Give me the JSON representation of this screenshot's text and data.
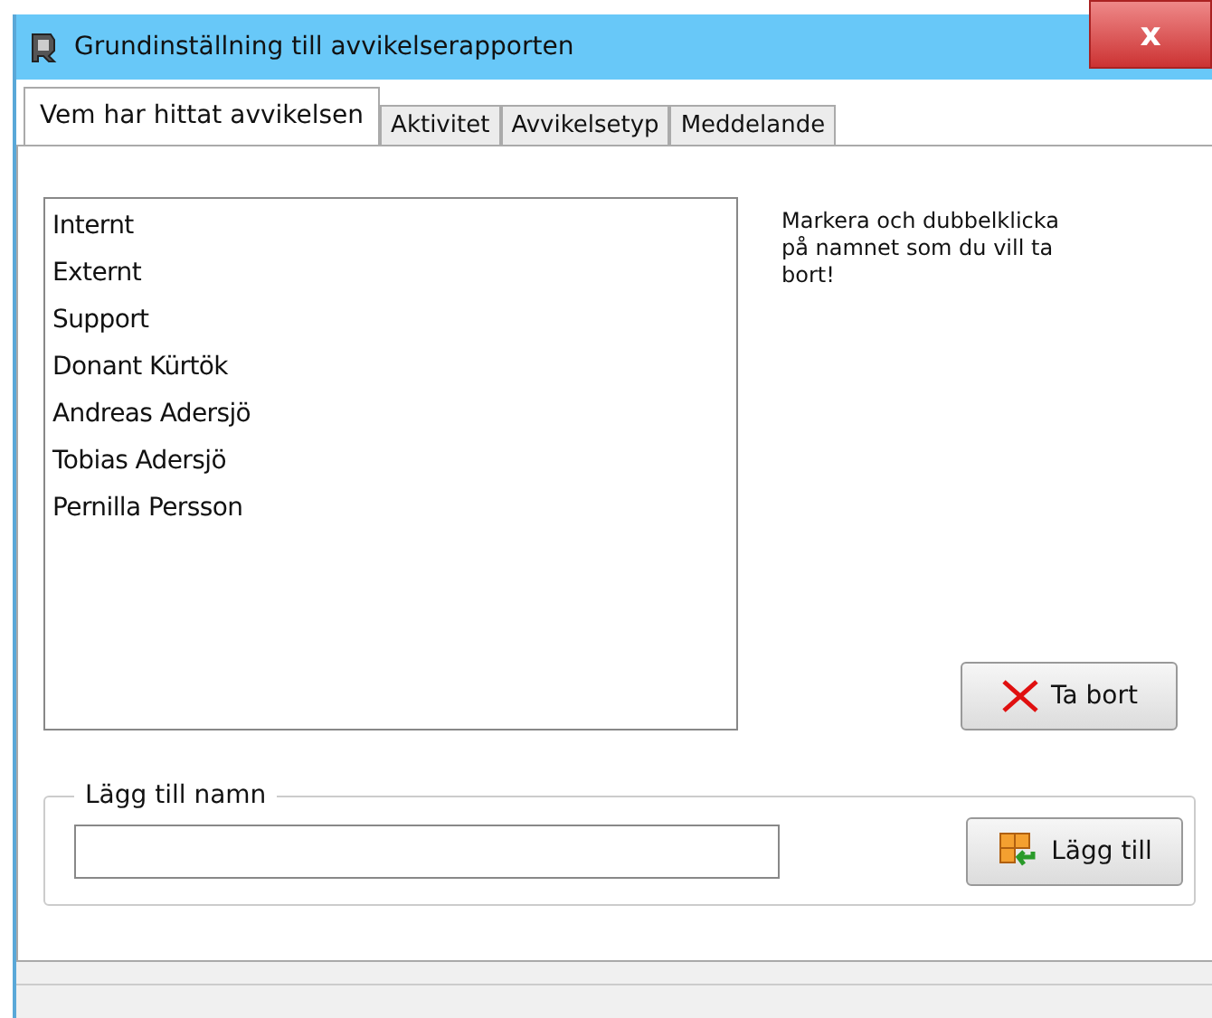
{
  "window": {
    "title": "Grundinställning till avvikelserapporten",
    "close": "x"
  },
  "tabs": [
    {
      "label": "Vem har hittat avvikelsen",
      "selected": true
    },
    {
      "label": "Aktivitet",
      "selected": false
    },
    {
      "label": "Avvikelsetyp",
      "selected": false
    },
    {
      "label": "Meddelande",
      "selected": false
    }
  ],
  "names_list": {
    "items": [
      "Internt",
      "Externt",
      "Support",
      "Donant Kürtök",
      "Andreas Adersjö",
      "Tobias Adersjö",
      "Pernilla Persson"
    ]
  },
  "help_text": "Markera och dubbelklicka på namnet  som du vill ta bort!",
  "remove_button": "Ta bort",
  "add_group": {
    "legend": "Lägg till namn",
    "button": "Lägg till"
  }
}
